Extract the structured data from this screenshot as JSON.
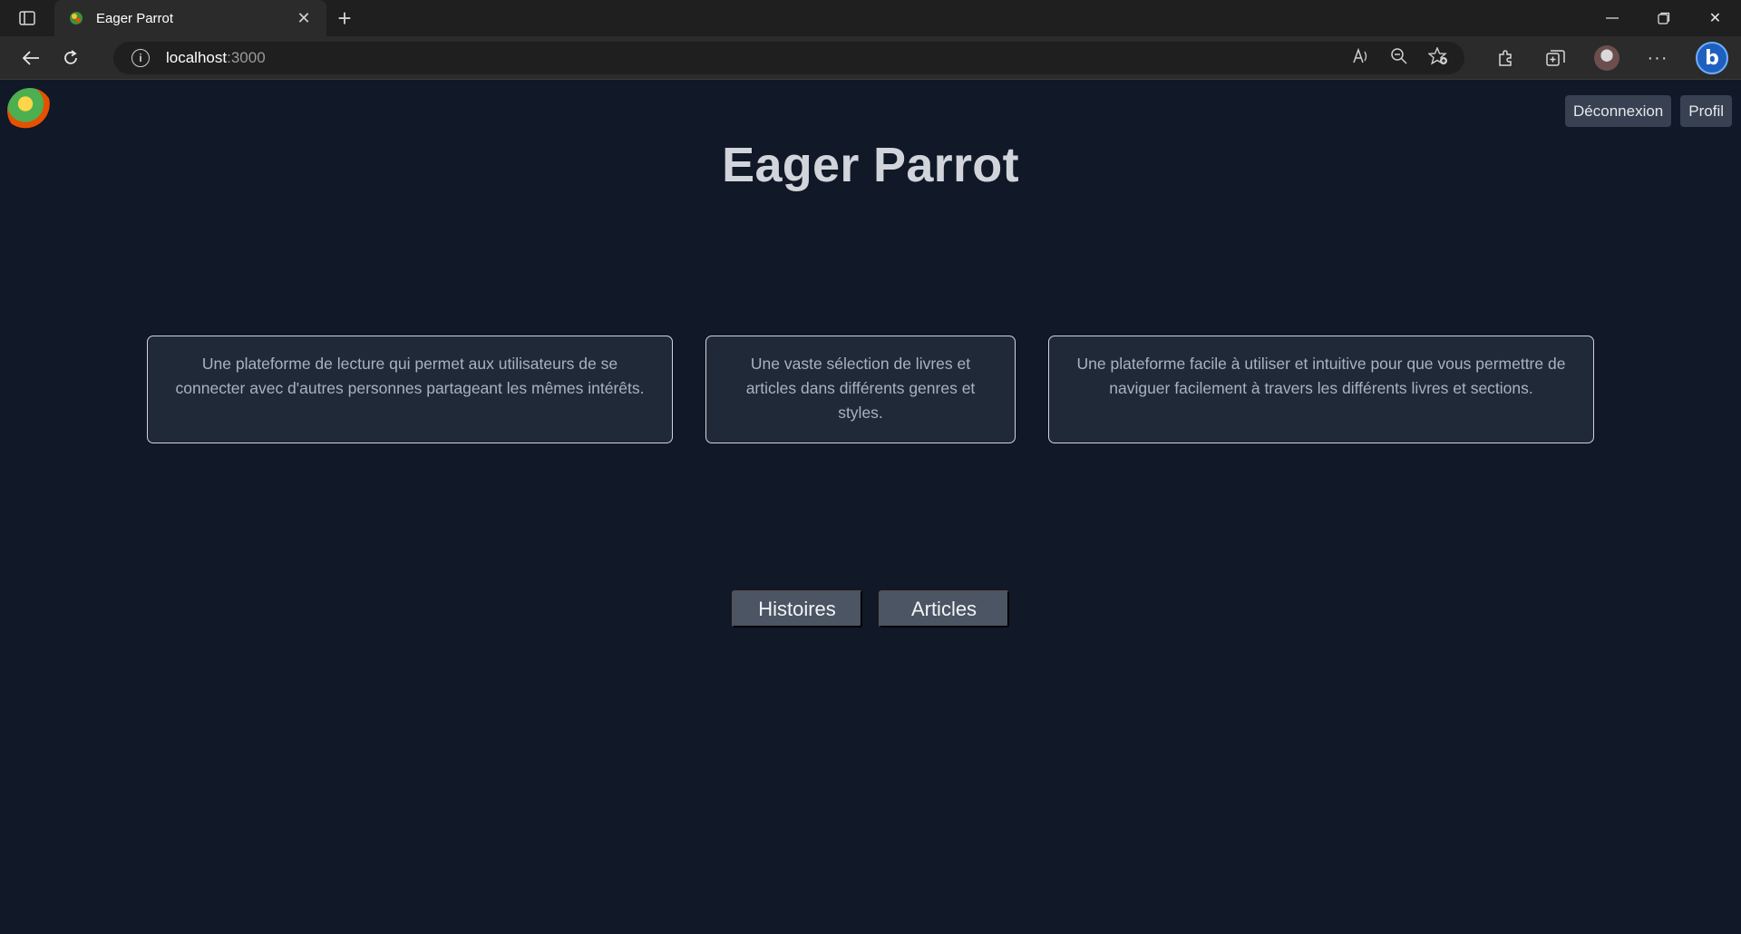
{
  "browser": {
    "tab_title": "Eager Parrot",
    "url_host": "localhost",
    "url_port": ":3000"
  },
  "header": {
    "logout_label": "Déconnexion",
    "profile_label": "Profil"
  },
  "main": {
    "title": "Eager Parrot",
    "cards": [
      "Une plateforme de lecture qui permet aux utilisateurs de se connecter avec d'autres personnes partageant les mêmes intérêts.",
      "Une vaste sélection de livres et articles dans différents genres et styles.",
      "Une plateforme facile à utiliser et intuitive pour que vous permettre de naviguer facilement à travers les différents livres et sections."
    ],
    "buttons": {
      "stories_label": "Histoires",
      "articles_label": "Articles"
    }
  },
  "icons": {
    "tab_actions": "tab-actions-icon",
    "favicon": "parrot-favicon-icon",
    "tab_close": "close-icon",
    "new_tab": "plus-icon",
    "minimize": "minimize-icon",
    "restore": "restore-icon",
    "window_close": "close-icon",
    "back": "back-arrow-icon",
    "refresh": "refresh-icon",
    "site_info": "info-icon",
    "read_aloud": "read-aloud-icon",
    "zoom": "zoom-out-icon",
    "favorite": "favorite-add-icon",
    "extensions": "extensions-icon",
    "collections": "collections-icon",
    "profile": "avatar-icon",
    "more": "more-icon",
    "bing": "bing-icon"
  },
  "colors": {
    "page_bg": "#111827",
    "card_bg": "#1f2937",
    "button_bg": "#4b5563",
    "top_button_bg": "#374151",
    "heading_color": "#d1d5db"
  }
}
